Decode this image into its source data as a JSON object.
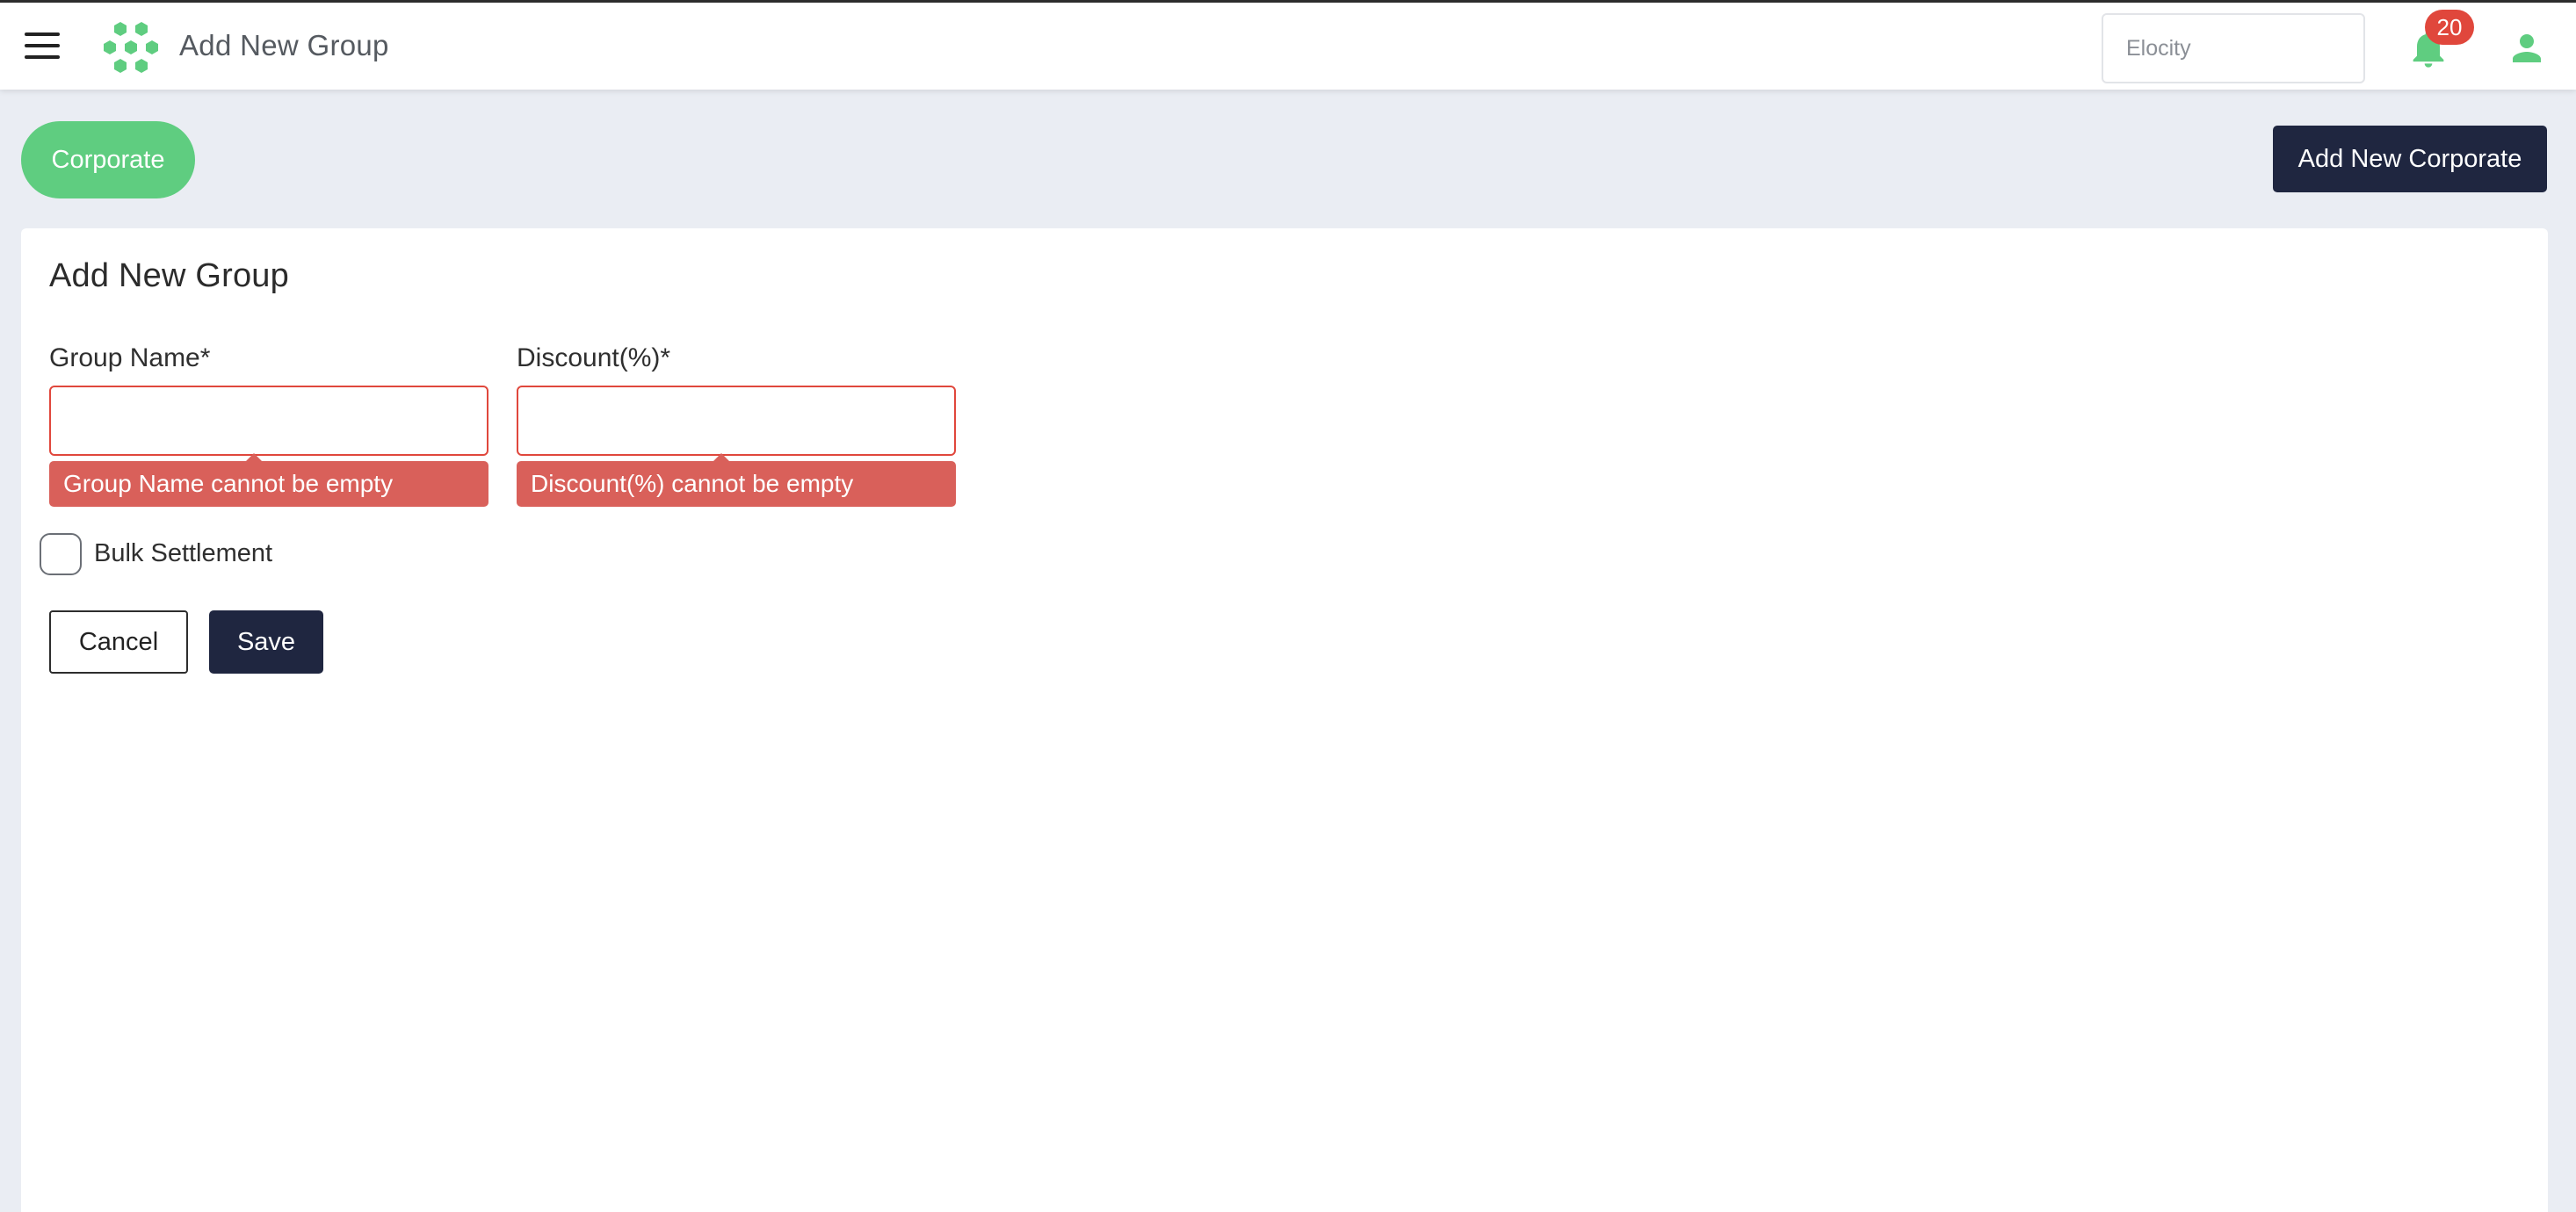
{
  "header": {
    "title": "Add New Group",
    "org_select_placeholder": "Elocity",
    "notification_count": "20"
  },
  "actions": {
    "corporate_label": "Corporate",
    "add_corporate_label": "Add New Corporate"
  },
  "form": {
    "title": "Add New Group",
    "group_name": {
      "label": "Group Name*",
      "value": "",
      "error": "Group Name cannot be empty"
    },
    "discount": {
      "label": "Discount(%)*",
      "value": "",
      "error": "Discount(%) cannot be empty"
    },
    "bulk_settlement_label": "Bulk Settlement",
    "bulk_settlement_checked": false,
    "cancel_label": "Cancel",
    "save_label": "Save"
  },
  "colors": {
    "brand_green": "#5fcd80",
    "navy": "#1f2640",
    "error_red": "#e0473c",
    "error_tip": "#d9605a",
    "background": "#eaedf3"
  },
  "icons": {
    "menu": "hamburger-icon",
    "logo": "hexagon-cluster-logo",
    "notifications": "bell-icon",
    "profile": "user-icon"
  }
}
